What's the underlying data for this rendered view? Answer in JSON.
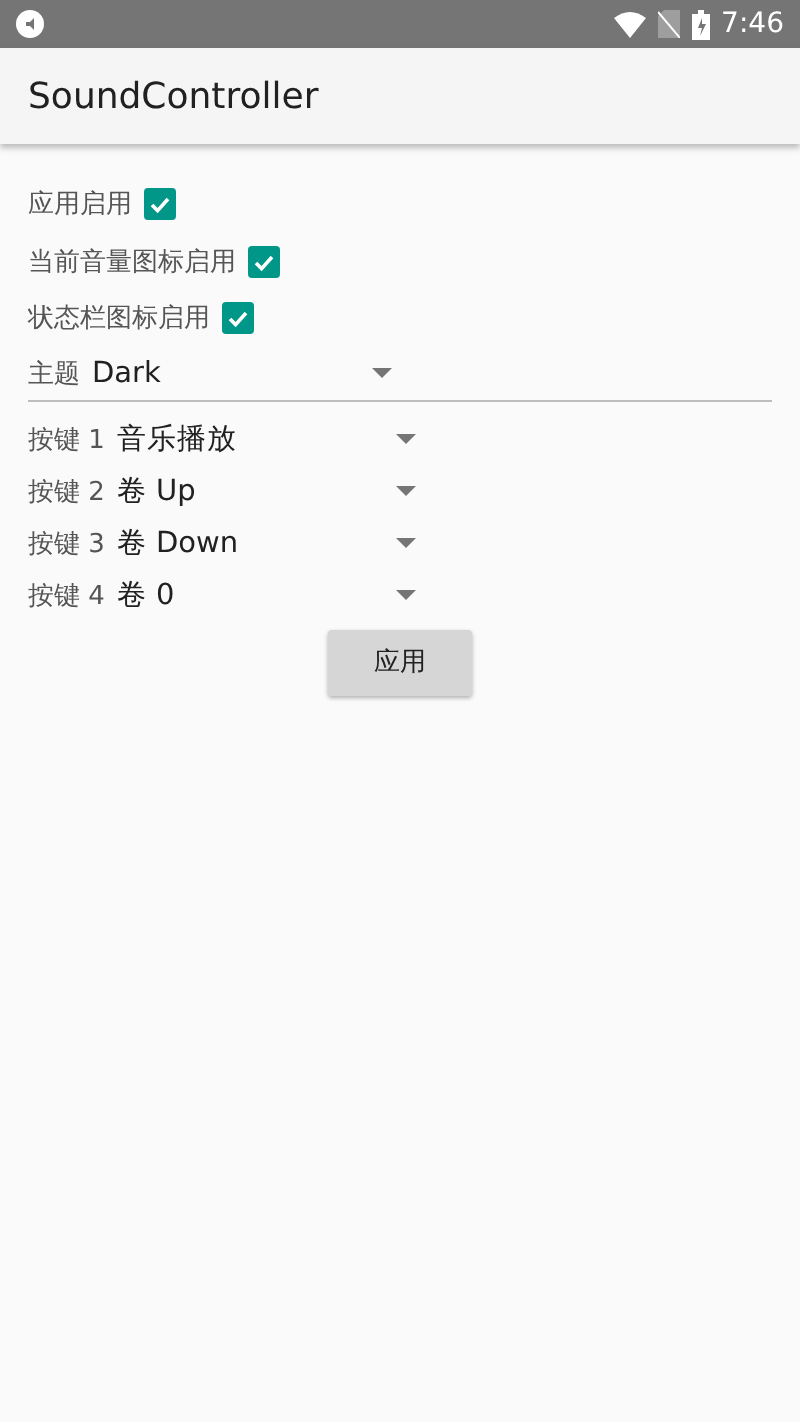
{
  "status_bar": {
    "time": "7:46"
  },
  "app_bar": {
    "title": "SoundController"
  },
  "toggles": [
    {
      "label": "应用启用",
      "checked": true
    },
    {
      "label": "当前音量图标启用",
      "checked": true
    },
    {
      "label": "状态栏图标启用",
      "checked": true
    }
  ],
  "theme": {
    "label": "主题",
    "value": "Dark"
  },
  "keys": [
    {
      "label": "按键 1",
      "value": "音乐播放"
    },
    {
      "label": "按键 2",
      "value": "卷 Up"
    },
    {
      "label": "按键 3",
      "value": "卷 Down"
    },
    {
      "label": "按键 4",
      "value": "卷 0"
    }
  ],
  "apply_button": "应用"
}
